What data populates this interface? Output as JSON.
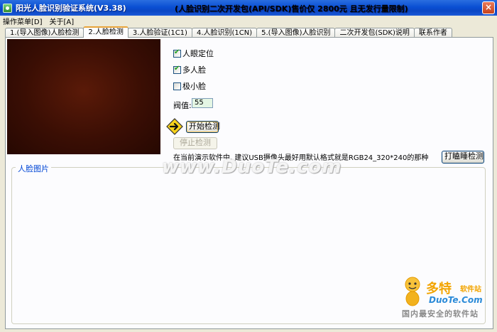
{
  "window": {
    "title": "阳光人脸识别验证系统(V3.38)",
    "notice": "(人脸识别二次开发包(API/SDK)售价仅 2800元 且无发行量限制)",
    "close_label": "×"
  },
  "menu": {
    "items": [
      "操作菜单[D]",
      "关于[A]"
    ]
  },
  "tabs": [
    {
      "label": "1.(导入图像)人脸检测",
      "active": false
    },
    {
      "label": "2.人脸检测",
      "active": true
    },
    {
      "label": "3.人脸验证(1C1)",
      "active": false
    },
    {
      "label": "4.人脸识别(1CN)",
      "active": false
    },
    {
      "label": "5.(导入图像)人脸识别",
      "active": false
    },
    {
      "label": "二次开发包(SDK)说明",
      "active": false
    },
    {
      "label": "联系作者",
      "active": false
    }
  ],
  "options": {
    "eye_locate": {
      "label": "人眼定位",
      "checked": true
    },
    "multi_face": {
      "label": "多人脸",
      "checked": true
    },
    "tiny_face": {
      "label": "极小脸",
      "checked": false
    }
  },
  "threshold": {
    "label": "阀值:",
    "value": "55"
  },
  "buttons": {
    "start": "开始检测",
    "stop": "停止检测",
    "doze": "打瞌睡检测"
  },
  "hint": "在当前演示软件中, 建议USB摄像头最好用默认格式就是RGB24_320*240的那种",
  "face_group": {
    "title": "人脸图片"
  },
  "watermark": {
    "center": "www.DuoTe.com",
    "brand": "多特",
    "brand_sub": "软件站",
    "site": "DuoTe.Com",
    "slogan": "国内最安全的软件站"
  },
  "colors": {
    "title_bar": "#0a4fd3",
    "tab_active_accent": "#e8a33a",
    "group_title": "#0046d5",
    "threshold_bg": "#e4f6e4"
  }
}
